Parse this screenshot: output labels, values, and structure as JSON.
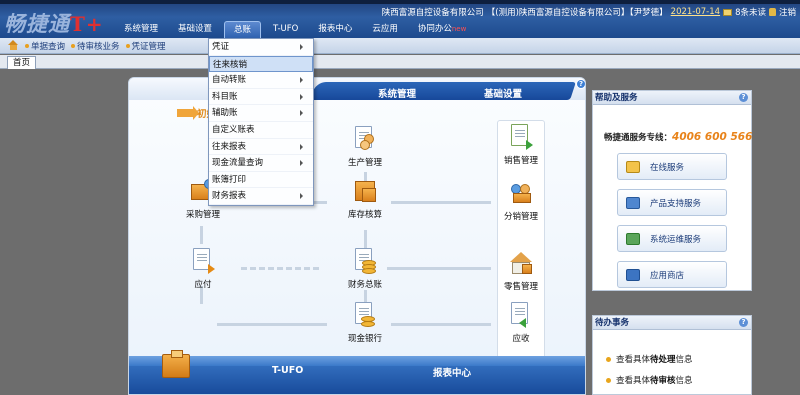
{
  "header": {
    "logo_text": "畅捷通",
    "logo_mark": "T+",
    "company": "陕西富源自控设备有限公司",
    "account": "【(测用)陕西富源自控设备有限公司】【尹梦德】",
    "date": "2021-07-14",
    "unread": "8条未读",
    "logout": "注销"
  },
  "main_nav": [
    {
      "label": "系统管理"
    },
    {
      "label": "基础设置"
    },
    {
      "label": "总账"
    },
    {
      "label": "T-UFO"
    },
    {
      "label": "报表中心"
    },
    {
      "label": "云应用"
    },
    {
      "label": "协同办公",
      "badge": "new"
    }
  ],
  "quick_links": [
    {
      "label": "单据查询"
    },
    {
      "label": "待审核业务"
    },
    {
      "label": "凭证管理"
    }
  ],
  "tabs": [
    {
      "label": "首页"
    }
  ],
  "dropdown": [
    {
      "label": "凭证",
      "submenu": true
    },
    {
      "label": "往来核销",
      "submenu": false
    },
    {
      "label": "自动转账",
      "submenu": true
    },
    {
      "label": "科目账",
      "submenu": true
    },
    {
      "label": "辅助账",
      "submenu": true
    },
    {
      "label": "自定义账表",
      "submenu": false
    },
    {
      "label": "往来报表",
      "submenu": true
    },
    {
      "label": "现金流量查询",
      "submenu": true
    },
    {
      "label": "账簿打印",
      "submenu": false
    },
    {
      "label": "财务报表",
      "submenu": true
    }
  ],
  "workspace": {
    "ribbon_left": "系统管理",
    "ribbon_right": "基础设置",
    "init_hint": "初始化导航",
    "bottom_mid": "T-UFO",
    "bottom_right": "报表中心",
    "flow": {
      "production": "生产管理",
      "purchase": "采购管理",
      "inventory": "库存核算",
      "sales_mgmt": "销售管理",
      "distribution": "分销管理",
      "payable": "应付",
      "finance": "财务总账",
      "retail": "零售管理",
      "cash_bank": "现金银行",
      "receivable": "应收"
    }
  },
  "help_panel": {
    "title": "帮助及服务",
    "hotline_label": "畅捷通服务专线：",
    "hotline_number": "4006 600 566",
    "buttons": [
      {
        "label": "在线服务",
        "icon": "chat-icon"
      },
      {
        "label": "产品支持服务",
        "icon": "monitor-icon"
      },
      {
        "label": "系统运维服务",
        "icon": "system-icon"
      },
      {
        "label": "应用商店",
        "icon": "store-icon"
      }
    ]
  },
  "todo_panel": {
    "title": "待办事务",
    "items": [
      {
        "prefix": "查看具体",
        "strong": "待处理",
        "suffix": "信息"
      },
      {
        "prefix": "查看具体",
        "strong": "待审核",
        "suffix": "信息"
      }
    ]
  }
}
